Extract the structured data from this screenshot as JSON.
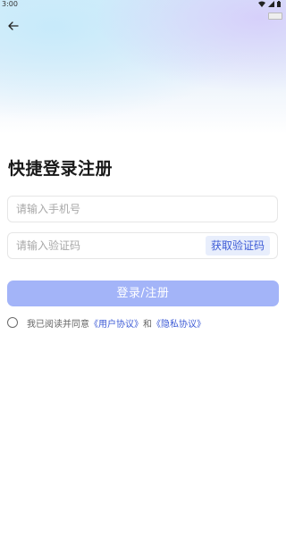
{
  "status_bar": {
    "time": "3:00",
    "icons": [
      "wifi-icon",
      "signal-icon",
      "battery-icon"
    ]
  },
  "header": {
    "back_icon": "arrow-left-icon"
  },
  "main": {
    "title": "快捷登录注册",
    "phone_placeholder": "请输入手机号",
    "phone_value": "",
    "code_placeholder": "请输入验证码",
    "code_value": "",
    "get_code_label": "获取验证码",
    "submit_label": "登录/注册"
  },
  "agreement": {
    "prefix": "我已阅读并同意",
    "user_agreement": "《用户协议》",
    "and": "和",
    "privacy_policy": "《隐私协议》"
  },
  "colors": {
    "accent": "#3d5bd6",
    "submit_disabled": "#a3b4f8",
    "code_button_bg": "#e8eefc"
  }
}
